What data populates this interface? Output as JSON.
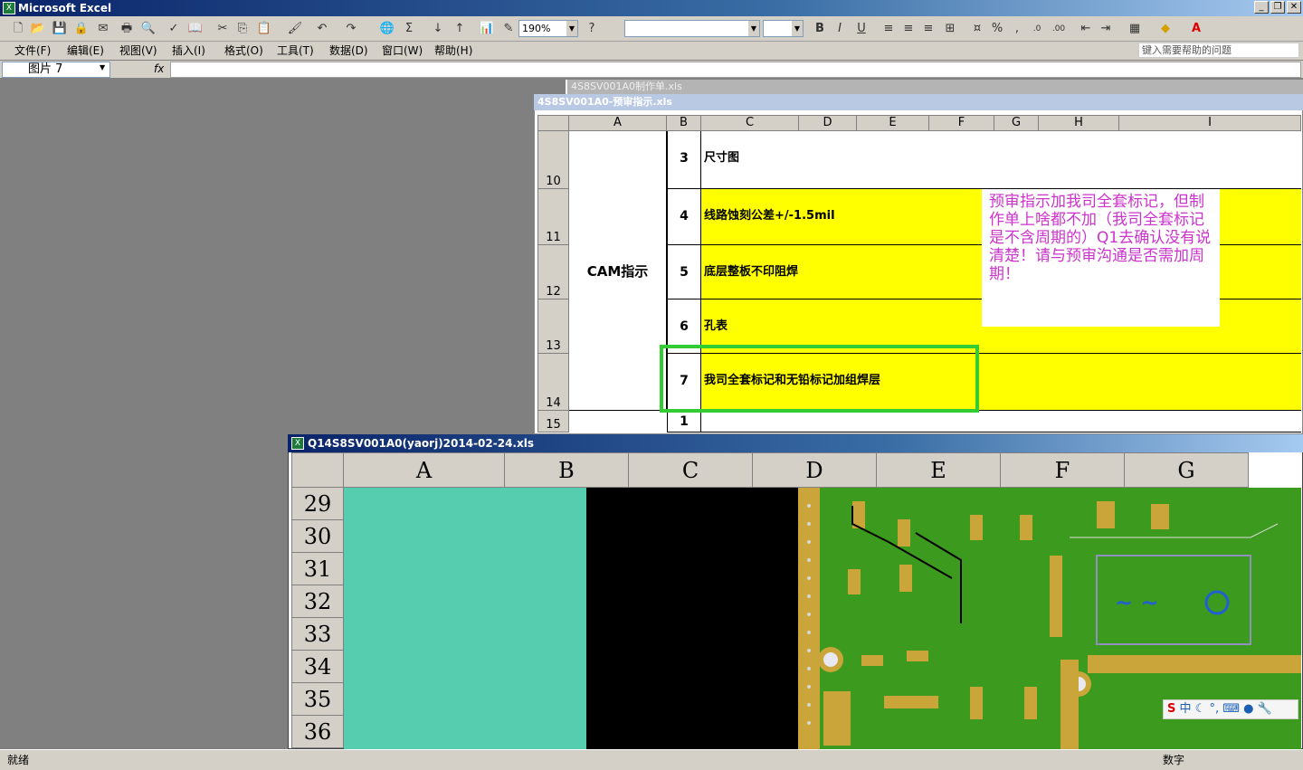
{
  "app": {
    "title": "Microsoft Excel",
    "icon": "X"
  },
  "toolbar": {
    "zoom": "190%",
    "icons": [
      "new-icon",
      "open-icon",
      "save-icon",
      "permission-icon",
      "email-icon",
      "print-icon",
      "preview-icon",
      "spell-icon",
      "research-icon",
      "cut-icon",
      "copy-icon",
      "paste-icon",
      "format-painter-icon",
      "undo-icon",
      "redo-icon",
      "hyperlink-icon",
      "sum-icon",
      "sort-asc-icon",
      "sort-desc-icon",
      "chart-icon",
      "drawing-icon",
      "help-icon"
    ],
    "format_icons": [
      "B",
      "I",
      "U"
    ]
  },
  "menu": {
    "items": [
      "文件(F)",
      "编辑(E)",
      "视图(V)",
      "插入(I)",
      "格式(O)",
      "工具(T)",
      "数据(D)",
      "窗口(W)",
      "帮助(H)"
    ],
    "help_placeholder": "键入需要帮助的问题"
  },
  "formula": {
    "name_box": "图片 7",
    "fx": "fx",
    "value": ""
  },
  "window1": {
    "title": "4S8SV001A0制作单.xls"
  },
  "window2": {
    "title": "4S8SV001A0-预审指示.xls",
    "columns": [
      "A",
      "B",
      "C",
      "D",
      "E",
      "F",
      "G",
      "H",
      "I"
    ],
    "rows": [
      {
        "row": "10",
        "num": "3",
        "text": "尺寸图",
        "highlight": false
      },
      {
        "row": "11",
        "num": "4",
        "text": "线路蚀刻公差+/-1.5mil",
        "highlight": true
      },
      {
        "row": "12",
        "num": "5",
        "text": "底层整板不印阻焊",
        "highlight": true
      },
      {
        "row": "13",
        "num": "6",
        "text": "孔表",
        "highlight": true
      },
      {
        "row": "14",
        "num": "7",
        "text": "我司全套标记和无铅标记加组焊层",
        "highlight": true
      },
      {
        "row": "15",
        "num": "1",
        "text": "",
        "highlight": false
      }
    ],
    "merged_label": "CAM指示",
    "note": "预审指示加我司全套标记，但制作单上啥都不加（我司全套标记是不含周期的）Q1去确认没有说清楚！请与预审沟通是否需加周期！"
  },
  "window3": {
    "title": "Q14S8SV001A0(yaorj)2014-02-24.xls",
    "columns": [
      "A",
      "B",
      "C",
      "D",
      "E",
      "F",
      "G"
    ],
    "rows": [
      "29",
      "30",
      "31",
      "32",
      "33",
      "34",
      "35",
      "36"
    ]
  },
  "ime": {
    "label": "中"
  },
  "status": {
    "left": "就绪",
    "right": "数字"
  },
  "colors": {
    "highlight": "#ffff00",
    "teal": "#55cdae",
    "pcb_green": "#3c9a1e",
    "note_text": "#cc33cc",
    "frame": "#33cc33"
  }
}
